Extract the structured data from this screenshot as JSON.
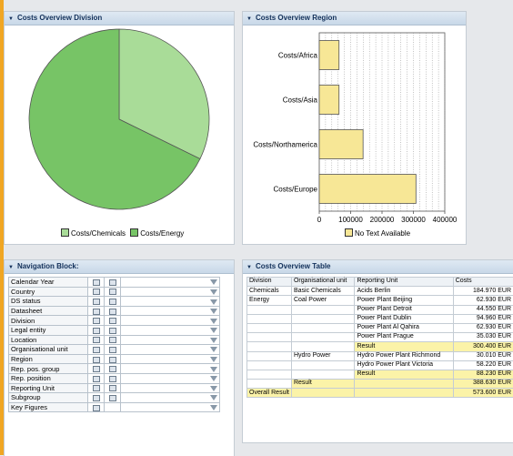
{
  "colors": {
    "accent": "#f0a623",
    "chemicals": "#a9dc98",
    "energy": "#77c466",
    "bar": "#f7e796",
    "result_row": "#fbf3a8",
    "header": "#12305a"
  },
  "division_panel": {
    "title": "Costs Overview Division",
    "chart_data": {
      "type": "pie",
      "categories": [
        "Costs/Chemicals",
        "Costs/Energy"
      ],
      "values": [
        184970,
        388630
      ],
      "legend": [
        "Costs/Chemicals",
        "Costs/Energy"
      ]
    }
  },
  "region_panel": {
    "title": "Costs Overview Region",
    "chart_data": {
      "type": "bar",
      "orientation": "horizontal",
      "categories": [
        "Costs/Africa",
        "Costs/Asia",
        "Costs/Northamerica",
        "Costs/Europe"
      ],
      "values": [
        62930,
        62930,
        139600,
        308140
      ],
      "xlim": [
        0,
        400000
      ],
      "xticks": [
        "0",
        "100000",
        "200000",
        "300000",
        "400000"
      ],
      "legend": [
        "No Text Available"
      ]
    }
  },
  "nav_panel": {
    "title": "Navigation Block:",
    "items": [
      {
        "label": "Calendar Year"
      },
      {
        "label": "Country"
      },
      {
        "label": "DS status"
      },
      {
        "label": "Datasheet"
      },
      {
        "label": "Division"
      },
      {
        "label": "Legal entity"
      },
      {
        "label": "Location"
      },
      {
        "label": "Organisational unit"
      },
      {
        "label": "Region"
      },
      {
        "label": "Rep. pos. group"
      },
      {
        "label": "Rep. position"
      },
      {
        "label": "Reporting Unit"
      },
      {
        "label": "Subgroup"
      },
      {
        "label": "Key Figures"
      }
    ]
  },
  "table_panel": {
    "title": "Costs Overview Table",
    "headers": [
      "Division",
      "Organisational unit",
      "Reporting Unit",
      "Costs"
    ],
    "rows": [
      [
        "Chemicals",
        "Basic Chemicals",
        "Acids Berlin",
        "184.970 EUR"
      ],
      [
        "Energy",
        "Coal Power",
        "Power Plant Beijing",
        "62.930 EUR"
      ],
      [
        "",
        "",
        "Power Plant Detroit",
        "44.550 EUR"
      ],
      [
        "",
        "",
        "Power Plant Dublin",
        "94.960 EUR"
      ],
      [
        "",
        "",
        "Power Plant Al Qahira",
        "62.930 EUR"
      ],
      [
        "",
        "",
        "Power Plant Prague",
        "35.030 EUR"
      ],
      [
        "",
        "",
        "Result",
        "300.400 EUR"
      ],
      [
        "",
        "Hydro Power",
        "Hydro Power Plant Richmond",
        "30.010 EUR"
      ],
      [
        "",
        "",
        "Hydro Power Plant Victoria",
        "58.220 EUR"
      ],
      [
        "",
        "",
        "Result",
        "88.230 EUR"
      ],
      [
        "",
        "Result",
        "",
        "388.630 EUR"
      ],
      [
        "Overall Result",
        "",
        "",
        "573.600 EUR"
      ]
    ]
  }
}
